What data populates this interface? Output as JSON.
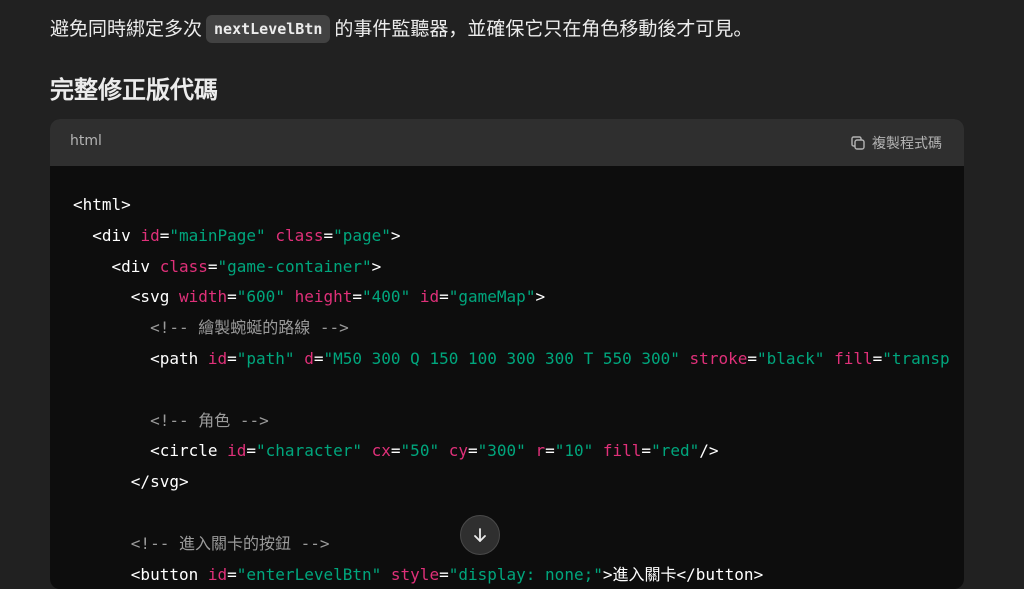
{
  "intro": {
    "before": "避免同時綁定多次",
    "code": "nextLevelBtn",
    "after": "的事件監聽器，並確保它只在角色移動後才可見。"
  },
  "heading": "完整修正版代碼",
  "code_block": {
    "language": "html",
    "copy_label": "複製程式碼",
    "copy_icon": "copy-icon",
    "lines": [
      [
        {
          "k": "t",
          "v": "<html>"
        }
      ],
      [
        {
          "k": "p",
          "v": "  "
        },
        {
          "k": "t",
          "v": "<div "
        },
        {
          "k": "a",
          "v": "id"
        },
        {
          "k": "p",
          "v": "="
        },
        {
          "k": "s",
          "v": "\"mainPage\""
        },
        {
          "k": "p",
          "v": " "
        },
        {
          "k": "a",
          "v": "class"
        },
        {
          "k": "p",
          "v": "="
        },
        {
          "k": "s",
          "v": "\"page\""
        },
        {
          "k": "t",
          "v": ">"
        }
      ],
      [
        {
          "k": "p",
          "v": "    "
        },
        {
          "k": "t",
          "v": "<div "
        },
        {
          "k": "a",
          "v": "class"
        },
        {
          "k": "p",
          "v": "="
        },
        {
          "k": "s",
          "v": "\"game-container\""
        },
        {
          "k": "t",
          "v": ">"
        }
      ],
      [
        {
          "k": "p",
          "v": "      "
        },
        {
          "k": "t",
          "v": "<svg "
        },
        {
          "k": "a",
          "v": "width"
        },
        {
          "k": "p",
          "v": "="
        },
        {
          "k": "s",
          "v": "\"600\""
        },
        {
          "k": "p",
          "v": " "
        },
        {
          "k": "a",
          "v": "height"
        },
        {
          "k": "p",
          "v": "="
        },
        {
          "k": "s",
          "v": "\"400\""
        },
        {
          "k": "p",
          "v": " "
        },
        {
          "k": "a",
          "v": "id"
        },
        {
          "k": "p",
          "v": "="
        },
        {
          "k": "s",
          "v": "\"gameMap\""
        },
        {
          "k": "t",
          "v": ">"
        }
      ],
      [
        {
          "k": "p",
          "v": "        "
        },
        {
          "k": "c",
          "v": "<!-- 繪製蜿蜒的路線 -->"
        }
      ],
      [
        {
          "k": "p",
          "v": "        "
        },
        {
          "k": "t",
          "v": "<path "
        },
        {
          "k": "a",
          "v": "id"
        },
        {
          "k": "p",
          "v": "="
        },
        {
          "k": "s",
          "v": "\"path\""
        },
        {
          "k": "p",
          "v": " "
        },
        {
          "k": "a",
          "v": "d"
        },
        {
          "k": "p",
          "v": "="
        },
        {
          "k": "s",
          "v": "\"M50 300 Q 150 100 300 300 T 550 300\""
        },
        {
          "k": "p",
          "v": " "
        },
        {
          "k": "a",
          "v": "stroke"
        },
        {
          "k": "p",
          "v": "="
        },
        {
          "k": "s",
          "v": "\"black\""
        },
        {
          "k": "p",
          "v": " "
        },
        {
          "k": "a",
          "v": "fill"
        },
        {
          "k": "p",
          "v": "="
        },
        {
          "k": "s",
          "v": "\"transp"
        }
      ],
      [],
      [
        {
          "k": "p",
          "v": "        "
        },
        {
          "k": "c",
          "v": "<!-- 角色 -->"
        }
      ],
      [
        {
          "k": "p",
          "v": "        "
        },
        {
          "k": "t",
          "v": "<circle "
        },
        {
          "k": "a",
          "v": "id"
        },
        {
          "k": "p",
          "v": "="
        },
        {
          "k": "s",
          "v": "\"character\""
        },
        {
          "k": "p",
          "v": " "
        },
        {
          "k": "a",
          "v": "cx"
        },
        {
          "k": "p",
          "v": "="
        },
        {
          "k": "s",
          "v": "\"50\""
        },
        {
          "k": "p",
          "v": " "
        },
        {
          "k": "a",
          "v": "cy"
        },
        {
          "k": "p",
          "v": "="
        },
        {
          "k": "s",
          "v": "\"300\""
        },
        {
          "k": "p",
          "v": " "
        },
        {
          "k": "a",
          "v": "r"
        },
        {
          "k": "p",
          "v": "="
        },
        {
          "k": "s",
          "v": "\"10\""
        },
        {
          "k": "p",
          "v": " "
        },
        {
          "k": "a",
          "v": "fill"
        },
        {
          "k": "p",
          "v": "="
        },
        {
          "k": "s",
          "v": "\"red\""
        },
        {
          "k": "t",
          "v": "/>"
        }
      ],
      [
        {
          "k": "p",
          "v": "      "
        },
        {
          "k": "t",
          "v": "</svg>"
        }
      ],
      [],
      [
        {
          "k": "p",
          "v": "      "
        },
        {
          "k": "c",
          "v": "<!-- 進入關卡的按鈕 -->"
        }
      ],
      [
        {
          "k": "p",
          "v": "      "
        },
        {
          "k": "t",
          "v": "<button "
        },
        {
          "k": "a",
          "v": "id"
        },
        {
          "k": "p",
          "v": "="
        },
        {
          "k": "s",
          "v": "\"enterLevelBtn\""
        },
        {
          "k": "p",
          "v": " "
        },
        {
          "k": "a",
          "v": "style"
        },
        {
          "k": "p",
          "v": "="
        },
        {
          "k": "s",
          "v": "\"display: none;\""
        },
        {
          "k": "t",
          "v": ">"
        },
        {
          "k": "p",
          "v": "進入關卡"
        },
        {
          "k": "t",
          "v": "</button>"
        }
      ]
    ]
  },
  "scroll_button": {
    "icon": "arrow-down-icon"
  },
  "colors": {
    "background": "#212121",
    "code_background": "#0d0d0d",
    "code_header": "#2f2f2f",
    "attr": "#df3079",
    "string": "#00a67d",
    "comment": "#9a9a9a"
  }
}
